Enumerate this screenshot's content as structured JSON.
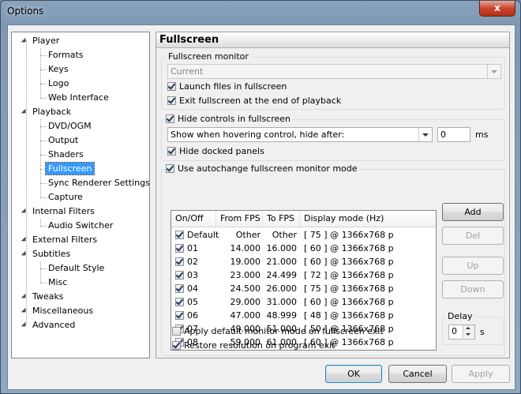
{
  "window": {
    "title": "Options",
    "close_label": "x"
  },
  "tree": [
    {
      "label": "Player",
      "level": 0,
      "expanded": true
    },
    {
      "label": "Formats",
      "level": 1
    },
    {
      "label": "Keys",
      "level": 1
    },
    {
      "label": "Logo",
      "level": 1
    },
    {
      "label": "Web Interface",
      "level": 1
    },
    {
      "label": "Playback",
      "level": 0,
      "expanded": true
    },
    {
      "label": "DVD/OGM",
      "level": 1
    },
    {
      "label": "Output",
      "level": 1
    },
    {
      "label": "Shaders",
      "level": 1
    },
    {
      "label": "Fullscreen",
      "level": 1,
      "selected": true
    },
    {
      "label": "Sync Renderer Settings",
      "level": 1
    },
    {
      "label": "Capture",
      "level": 1
    },
    {
      "label": "Internal Filters",
      "level": 0,
      "expanded": true
    },
    {
      "label": "Audio Switcher",
      "level": 1
    },
    {
      "label": "External Filters",
      "level": 0
    },
    {
      "label": "Subtitles",
      "level": 0,
      "expanded": true
    },
    {
      "label": "Default Style",
      "level": 1
    },
    {
      "label": "Misc",
      "level": 1
    },
    {
      "label": "Tweaks",
      "level": 0
    },
    {
      "label": "Miscellaneous",
      "level": 0
    },
    {
      "label": "Advanced",
      "level": 0
    }
  ],
  "panel": {
    "title": "Fullscreen",
    "monitor_group": "Fullscreen monitor",
    "monitor_value": "Current",
    "launch_fullscreen": "Launch files in fullscreen",
    "exit_fullscreen": "Exit fullscreen at the end of playback",
    "hide_controls": "Hide controls in fullscreen",
    "hide_mode": "Show when hovering control, hide after:",
    "hide_delay": "0",
    "hide_delay_unit": "ms",
    "hide_docked": "Hide docked panels",
    "autochange": "Use autochange fullscreen monitor mode",
    "columns": [
      "On/Off",
      "From FPS",
      "To FPS",
      "Display mode (Hz)"
    ],
    "rows": [
      {
        "name": "Default",
        "from": "Other",
        "to": "Other",
        "mode": "[ 75 ] @ 1366x768 p"
      },
      {
        "name": "01",
        "from": "14.000",
        "to": "16.000",
        "mode": "[ 60 ] @ 1366x768 p"
      },
      {
        "name": "02",
        "from": "19.000",
        "to": "21.000",
        "mode": "[ 60 ] @ 1366x768 p"
      },
      {
        "name": "03",
        "from": "23.000",
        "to": "24.499",
        "mode": "[ 72 ] @ 1366x768 p"
      },
      {
        "name": "04",
        "from": "24.500",
        "to": "26.000",
        "mode": "[ 75 ] @ 1366x768 p"
      },
      {
        "name": "05",
        "from": "29.000",
        "to": "31.000",
        "mode": "[ 60 ] @ 1366x768 p"
      },
      {
        "name": "06",
        "from": "47.000",
        "to": "48.999",
        "mode": "[ 48 ] @ 1366x768 p"
      },
      {
        "name": "07",
        "from": "49.000",
        "to": "51.000",
        "mode": "[ 50 ] @ 1366x768 p"
      },
      {
        "name": "08",
        "from": "59.000",
        "to": "61.000",
        "mode": "[ 60 ] @ 1366x768 p"
      }
    ],
    "btn_add": "Add",
    "btn_del": "Del",
    "btn_up": "Up",
    "btn_down": "Down",
    "delay_label": "Delay",
    "delay_value": "0",
    "delay_unit": "s",
    "apply_default": "Apply default monitor mode on fullscreen exit",
    "restore_res": "Restore resolution on program exit"
  },
  "footer": {
    "ok": "OK",
    "cancel": "Cancel",
    "apply": "Apply"
  }
}
